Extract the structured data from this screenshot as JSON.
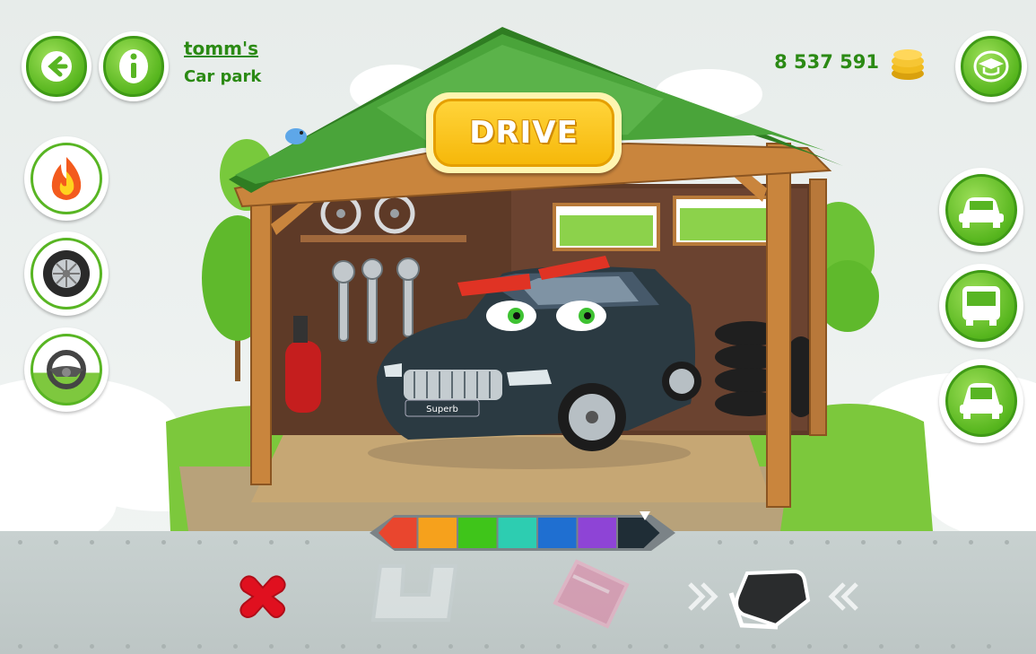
{
  "header": {
    "user_title": "tomm's",
    "subtitle": "Car park",
    "coin_amount": "8 537 591"
  },
  "main": {
    "drive_label": "DRIVE",
    "car_plate": "Superb"
  },
  "palette": {
    "colors": [
      "#e9462e",
      "#f6a11c",
      "#3fc51a",
      "#2dcdb1",
      "#1f6fd1",
      "#8e44d6",
      "#1f2d36"
    ],
    "selected_index": 6
  },
  "colors": {
    "accent_green": "#58b523",
    "text_green": "#2b8a14",
    "roof_green": "#3a8f2a"
  }
}
